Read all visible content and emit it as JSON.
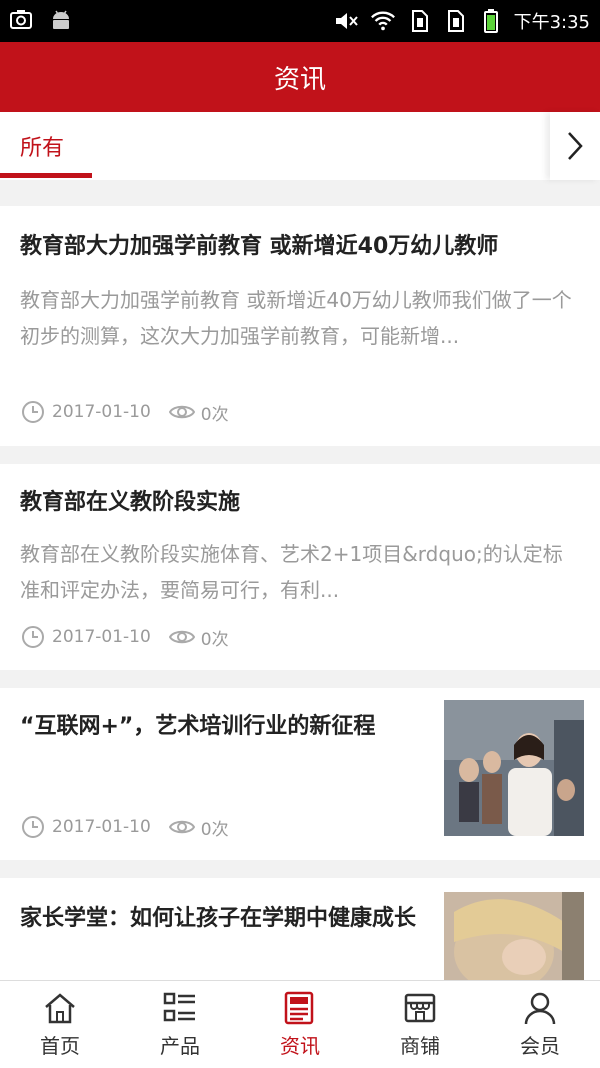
{
  "status": {
    "time": "下午3:35"
  },
  "header": {
    "title": "资讯"
  },
  "tabs": {
    "all": "所有"
  },
  "articles": [
    {
      "title": "教育部大力加强学前教育 或新增近40万幼儿教师",
      "summary": "教育部大力加强学前教育 或新增近40万幼儿教师我们做了一个初步的测算，这次大力加强学前教育，可能新增...",
      "date": "2017-01-10",
      "views": "0次"
    },
    {
      "title": "教育部在义教阶段实施",
      "summary": "教育部在义教阶段实施体育、艺术2+1项目&rdquo;的认定标准和评定办法，要简易可行，有利...",
      "date": "2017-01-10",
      "views": "0次"
    },
    {
      "title": "“互联网+”，艺术培训行业的新征程",
      "date": "2017-01-10",
      "views": "0次"
    },
    {
      "title": "家长学堂：如何让孩子在学期中健康成长"
    }
  ],
  "nav": [
    {
      "label": "首页",
      "icon": "home-icon"
    },
    {
      "label": "产品",
      "icon": "list-icon"
    },
    {
      "label": "资讯",
      "icon": "news-icon"
    },
    {
      "label": "商铺",
      "icon": "store-icon"
    },
    {
      "label": "会员",
      "icon": "user-icon"
    }
  ],
  "colors": {
    "accent": "#c1121a"
  }
}
